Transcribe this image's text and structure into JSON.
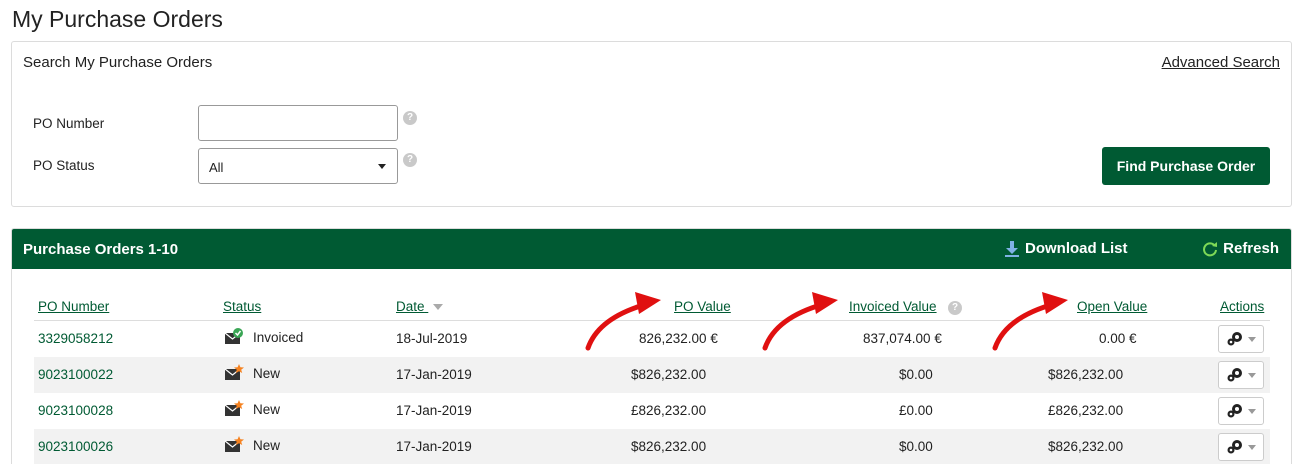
{
  "page_title": "My Purchase Orders",
  "search": {
    "title": "Search My Purchase Orders",
    "advanced_link": "Advanced Search",
    "po_number_label": "PO Number",
    "po_number_value": "",
    "po_status_label": "PO Status",
    "po_status_value": "All",
    "help_glyph": "?",
    "find_button": "Find Purchase Order"
  },
  "results": {
    "title": "Purchase Orders 1-10",
    "download_label": "Download List",
    "refresh_label": "Refresh",
    "columns": {
      "po_number": "PO Number",
      "status": "Status",
      "date": "Date",
      "po_value": "PO Value",
      "invoiced_value": "Invoiced Value",
      "open_value": "Open Value",
      "actions": "Actions"
    },
    "rows": [
      {
        "po_number": "3329058212",
        "status": "Invoiced",
        "status_icon": "envelope-check-icon",
        "date": "18-Jul-2019",
        "po_value": "826,232.00 €",
        "invoiced_value": "837,074.00 €",
        "open_value": "0.00 €"
      },
      {
        "po_number": "9023100022",
        "status": "New",
        "status_icon": "envelope-new-icon",
        "date": "17-Jan-2019",
        "po_value": "$826,232.00",
        "invoiced_value": "$0.00",
        "open_value": "$826,232.00"
      },
      {
        "po_number": "9023100028",
        "status": "New",
        "status_icon": "envelope-new-icon",
        "date": "17-Jan-2019",
        "po_value": "£826,232.00",
        "invoiced_value": "£0.00",
        "open_value": "£826,232.00"
      },
      {
        "po_number": "9023100026",
        "status": "New",
        "status_icon": "envelope-new-icon",
        "date": "17-Jan-2019",
        "po_value": "$826,232.00",
        "invoiced_value": "$0.00",
        "open_value": "$826,232.00"
      }
    ]
  },
  "colors": {
    "brand_green": "#005a33",
    "annotation_red": "#e01010",
    "new_badge_orange": "#f58220",
    "invoiced_badge_green": "#3aa655"
  }
}
